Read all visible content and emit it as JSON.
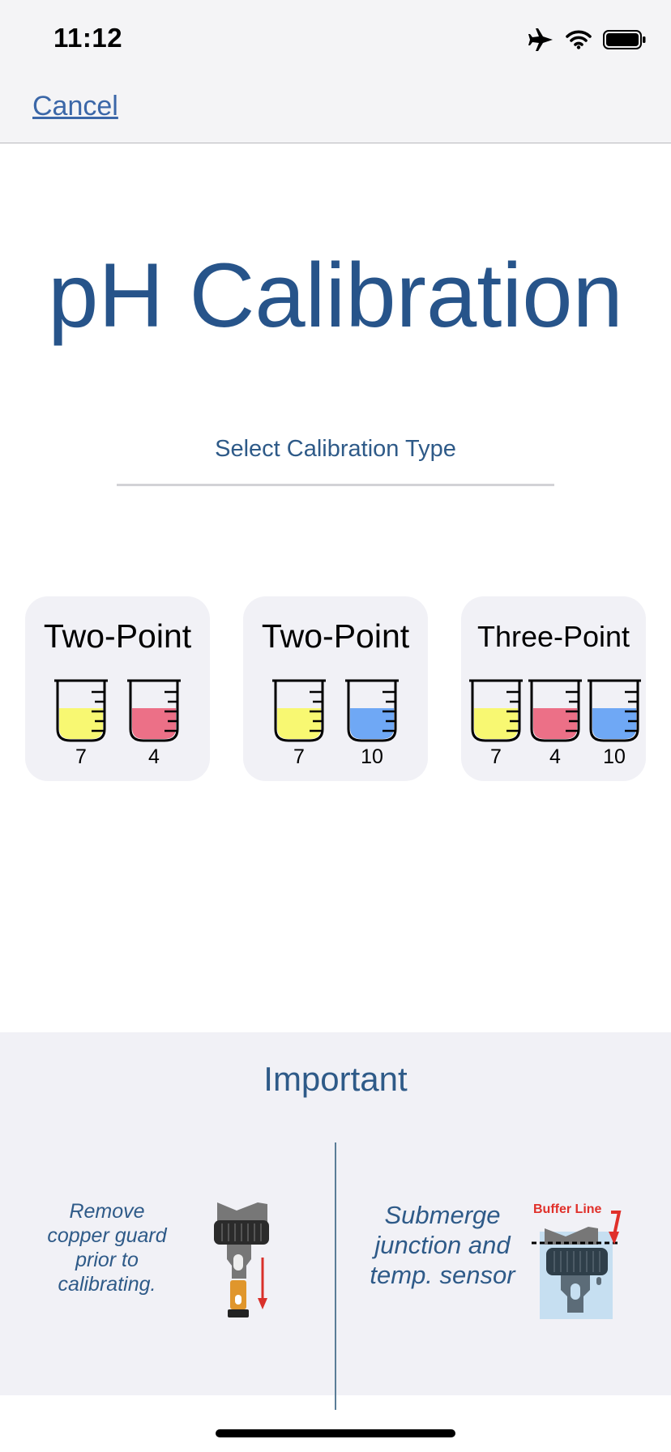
{
  "status_bar": {
    "time": "11:12",
    "icons": [
      "airplane-icon",
      "wifi-icon",
      "battery-icon"
    ]
  },
  "nav": {
    "cancel_label": "Cancel"
  },
  "page": {
    "title": "pH Calibration",
    "select_label": "Select Calibration Type"
  },
  "calibration_options": [
    {
      "title": "Two-Point",
      "beakers": [
        {
          "label": "7",
          "color": "#f8f872"
        },
        {
          "label": "4",
          "color": "#ec7087"
        }
      ]
    },
    {
      "title": "Two-Point",
      "beakers": [
        {
          "label": "7",
          "color": "#f8f872"
        },
        {
          "label": "10",
          "color": "#6fa8f5"
        }
      ]
    },
    {
      "title": "Three-Point",
      "beakers": [
        {
          "label": "7",
          "color": "#f8f872"
        },
        {
          "label": "4",
          "color": "#ec7087"
        },
        {
          "label": "10",
          "color": "#6fa8f5"
        }
      ]
    }
  ],
  "important": {
    "title": "Important",
    "tips": [
      {
        "text": "Remove copper guard prior to calibrating.",
        "icon": "probe-remove-guard-icon"
      },
      {
        "text": "Submerge junction and temp. sensor",
        "icon": "probe-buffer-line-icon",
        "figure_label": "Buffer Line"
      }
    ]
  },
  "colors": {
    "accent_blue": "#27548a",
    "link_blue": "#3b67a8",
    "panel_bg": "#f1f1f6",
    "buffer_line_red": "#e0302a"
  }
}
